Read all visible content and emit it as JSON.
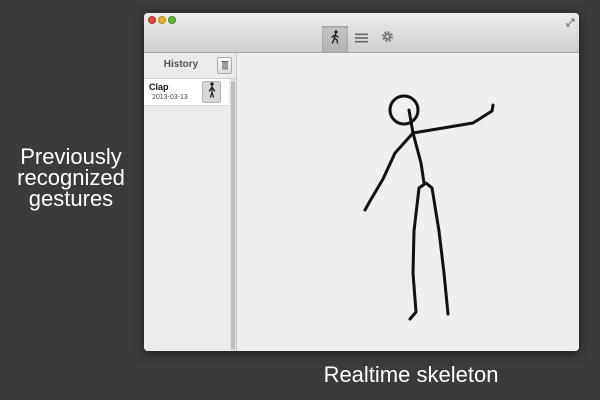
{
  "captions": {
    "left_lines": [
      "Previously",
      "recognized",
      "gestures"
    ],
    "bottom": "Realtime skeleton"
  },
  "window": {
    "toolbar": [
      {
        "icon": "walking-figure-icon",
        "active": true
      },
      {
        "icon": "list-lines-icon",
        "active": false
      },
      {
        "icon": "gear-icon",
        "active": false
      }
    ]
  },
  "sidebar": {
    "title": "History",
    "items": [
      {
        "name": "Clap",
        "date": "2013-03-13",
        "thumb_icon": "standing-figure-icon"
      }
    ]
  },
  "skeleton": {
    "stroke_color": "#111111",
    "joints": "head, neck, shoulders, right arm raised to the side, left arm hanging down, pelvis, two legs"
  }
}
